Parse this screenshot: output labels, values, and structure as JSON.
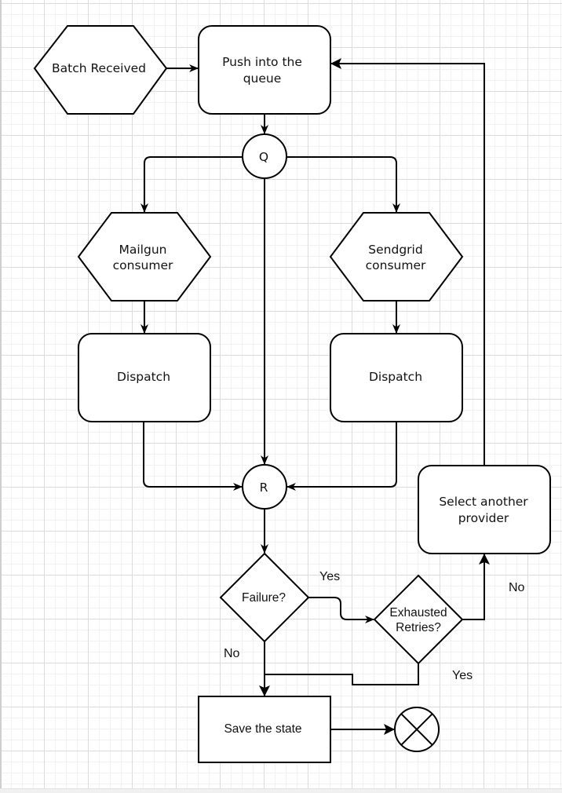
{
  "diagram": {
    "type": "flowchart",
    "nodes": {
      "batch_received": {
        "label": "Batch Received",
        "shape": "hexagon"
      },
      "push_queue": {
        "label_line1": "Push into the",
        "label_line2": "queue",
        "shape": "rounded-rectangle"
      },
      "q_junction": {
        "label": "Q",
        "shape": "circle"
      },
      "mailgun_consumer": {
        "label_line1": "Mailgun",
        "label_line2": "consumer",
        "shape": "hexagon"
      },
      "sendgrid_consumer": {
        "label_line1": "Sendgrid",
        "label_line2": "consumer",
        "shape": "hexagon"
      },
      "mailgun_dispatch": {
        "label": "Dispatch",
        "shape": "rounded-rectangle"
      },
      "sendgrid_dispatch": {
        "label": "Dispatch",
        "shape": "rounded-rectangle"
      },
      "r_junction": {
        "label": "R",
        "shape": "circle"
      },
      "failure_decision": {
        "label": "Failure?",
        "shape": "diamond"
      },
      "exhausted_decision": {
        "label_line1": "Exhausted",
        "label_line2": "Retries?",
        "shape": "diamond"
      },
      "select_provider": {
        "label_line1": "Select another",
        "label_line2": "provider",
        "shape": "rounded-rectangle"
      },
      "save_state": {
        "label": "Save the state",
        "shape": "rectangle"
      },
      "terminator": {
        "label": "",
        "shape": "circle-x"
      }
    },
    "edges": {
      "failure_yes": "Yes",
      "failure_no": "No",
      "exhausted_no": "No",
      "exhausted_yes": "Yes"
    },
    "connections": [
      [
        "batch_received",
        "push_queue"
      ],
      [
        "push_queue",
        "q_junction"
      ],
      [
        "q_junction",
        "mailgun_consumer"
      ],
      [
        "q_junction",
        "sendgrid_consumer"
      ],
      [
        "q_junction",
        "r_junction"
      ],
      [
        "mailgun_consumer",
        "mailgun_dispatch"
      ],
      [
        "sendgrid_consumer",
        "sendgrid_dispatch"
      ],
      [
        "mailgun_dispatch",
        "r_junction"
      ],
      [
        "sendgrid_dispatch",
        "r_junction"
      ],
      [
        "r_junction",
        "failure_decision"
      ],
      [
        "failure_decision",
        "exhausted_decision",
        "Yes"
      ],
      [
        "failure_decision",
        "save_state",
        "No"
      ],
      [
        "exhausted_decision",
        "select_provider",
        "No"
      ],
      [
        "exhausted_decision",
        "save_state",
        "Yes"
      ],
      [
        "select_provider",
        "push_queue"
      ],
      [
        "save_state",
        "terminator"
      ]
    ]
  }
}
